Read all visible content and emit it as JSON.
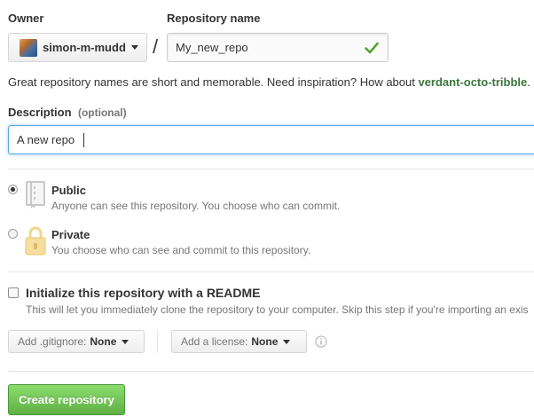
{
  "owner": {
    "label": "Owner",
    "name": "simon-m-mudd"
  },
  "repo": {
    "label": "Repository name",
    "value": "My_new_repo",
    "separator": "/"
  },
  "suggestion": {
    "text": "Great repository names are short and memorable. Need inspiration? How about ",
    "name": "verdant-octo-tribble",
    "suffix": "."
  },
  "description": {
    "label": "Description",
    "optional": "(optional)",
    "value": "A new repo"
  },
  "visibility": {
    "public": {
      "title": "Public",
      "desc": "Anyone can see this repository. You choose who can commit."
    },
    "private": {
      "title": "Private",
      "desc": "You choose who can see and commit to this repository."
    }
  },
  "init": {
    "title": "Initialize this repository with a README",
    "desc": "This will let you immediately clone the repository to your computer. Skip this step if you're importing an exis"
  },
  "gitignore": {
    "prefix": "Add .gitignore:",
    "value": "None"
  },
  "license": {
    "prefix": "Add a license:",
    "value": "None"
  },
  "submit": {
    "label": "Create repository"
  },
  "colors": {
    "accent_green": "#55a532",
    "focus_border": "#51a7e8",
    "suggestion_green": "#3c763d"
  }
}
